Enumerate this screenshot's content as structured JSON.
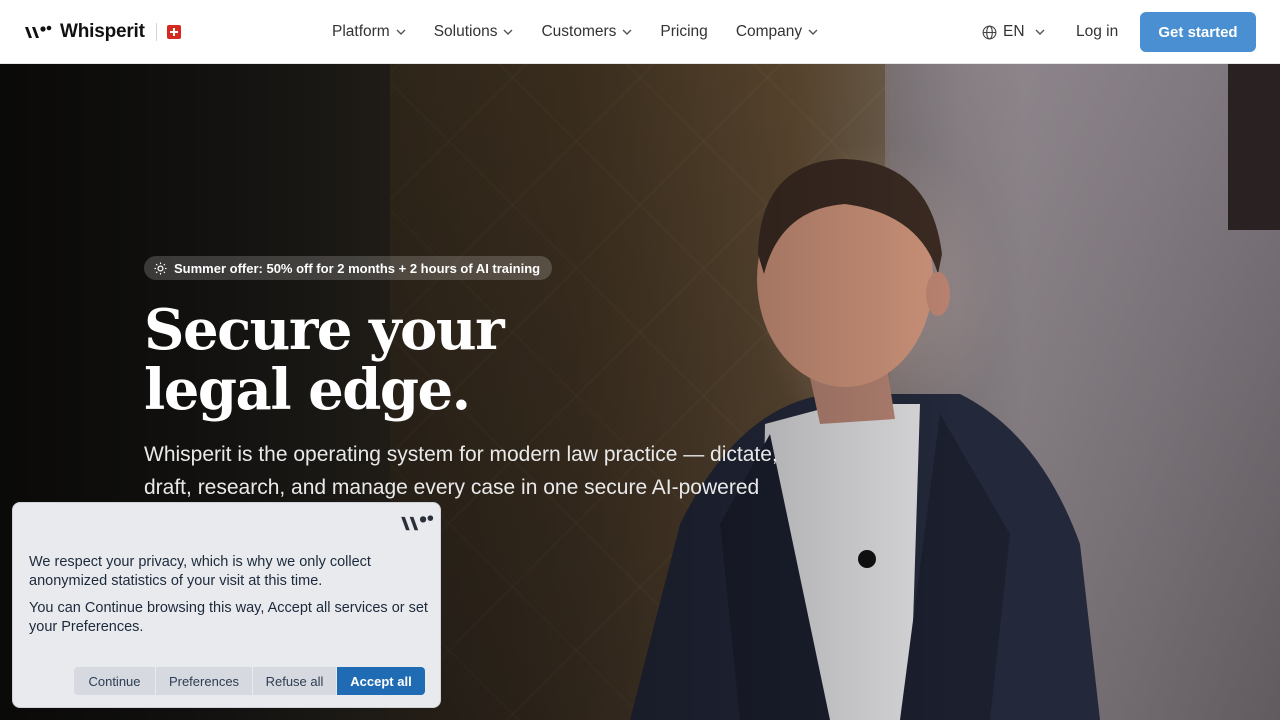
{
  "header": {
    "logo_text": "Whisperit",
    "nav": [
      {
        "label": "Platform",
        "has_dropdown": true
      },
      {
        "label": "Solutions",
        "has_dropdown": true
      },
      {
        "label": "Customers",
        "has_dropdown": true
      },
      {
        "label": "Pricing",
        "has_dropdown": false
      },
      {
        "label": "Company",
        "has_dropdown": true
      }
    ],
    "language": "EN",
    "login_label": "Log in",
    "cta_label": "Get started"
  },
  "hero": {
    "offer_badge": "Summer offer: 50% off for 2 months + 2 hours of AI training",
    "title_line1": "Secure your",
    "title_line2": "legal edge.",
    "subtitle": "Whisperit is the operating system for modern law practice — dictate, draft, research, and manage every case in one secure AI-powered"
  },
  "cookie": {
    "text1": "We respect your privacy, which is why we only collect anonymized statistics of your visit at this time.",
    "text2": "You can Continue browsing this way, Accept all services or set your Preferences.",
    "buttons": {
      "continue": "Continue",
      "preferences": "Preferences",
      "refuse": "Refuse all",
      "accept": "Accept all"
    }
  },
  "colors": {
    "cta": "#4a8fd1",
    "accept": "#1f6cb5",
    "swiss_red": "#d52b1e"
  },
  "icons": [
    "whisperit-logo-icon",
    "swiss-flag-icon",
    "chevron-down-icon",
    "globe-icon",
    "sun-icon"
  ]
}
